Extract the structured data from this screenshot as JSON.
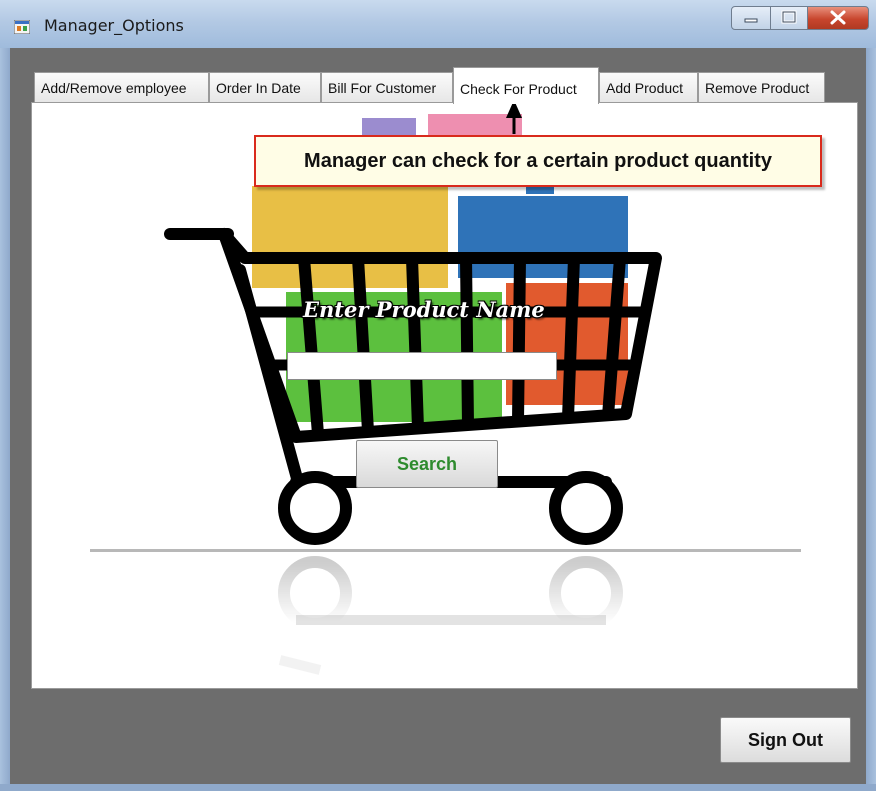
{
  "window": {
    "title": "Manager_Options"
  },
  "tabs": [
    {
      "label": "Add/Remove employee",
      "active": false
    },
    {
      "label": "Order In Date",
      "active": false
    },
    {
      "label": "Bill For Customer",
      "active": false
    },
    {
      "label": "Check For Product",
      "active": true
    },
    {
      "label": "Add Product",
      "active": false
    },
    {
      "label": "Remove Product",
      "active": false
    }
  ],
  "callout": {
    "text": "Manager can check for a certain product quantity"
  },
  "product_search": {
    "label": "Enter Product Name",
    "value": "",
    "button_label": "Search"
  },
  "footer": {
    "sign_out_label": "Sign Out"
  },
  "icons": [
    "app-icon",
    "minimize-icon",
    "maximize-icon",
    "close-icon",
    "shopping-cart-illustration",
    "arrow-annotation"
  ],
  "colors": {
    "callout_border": "#d92a1c",
    "search_text": "#2e8b2e",
    "client_background": "#6d6d6d"
  }
}
